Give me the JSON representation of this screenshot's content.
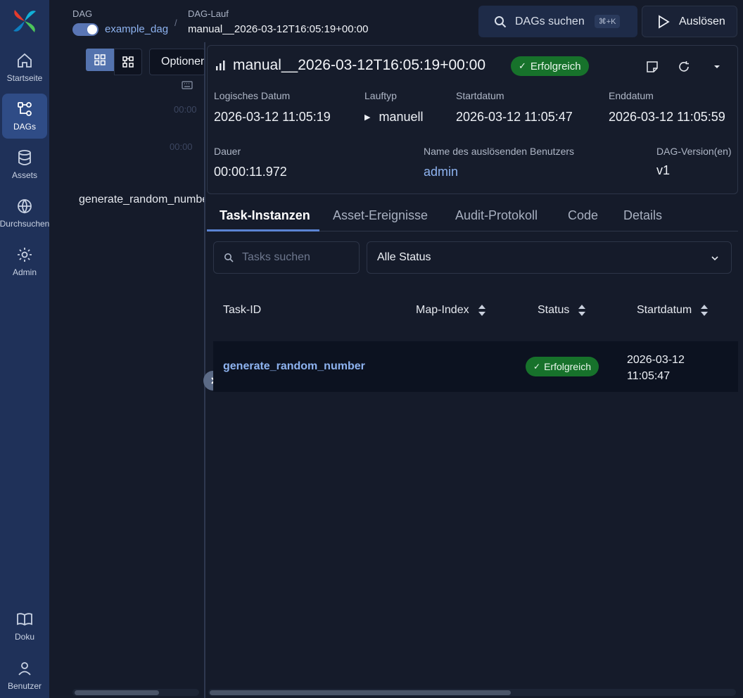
{
  "sidebar": {
    "items": [
      {
        "label": "Startseite",
        "icon": "home-icon"
      },
      {
        "label": "DAGs",
        "icon": "dags-icon"
      },
      {
        "label": "Assets",
        "icon": "database-icon"
      },
      {
        "label": "Durchsuchen",
        "icon": "globe-icon"
      },
      {
        "label": "Admin",
        "icon": "gear-icon"
      }
    ],
    "bottom": [
      {
        "label": "Doku",
        "icon": "book-icon"
      },
      {
        "label": "Benutzer",
        "icon": "user-icon"
      }
    ]
  },
  "header": {
    "dag_label": "DAG",
    "dag_name": "example_dag",
    "run_label": "DAG-Lauf",
    "run_name": "manual__2026-03-12T16:05:19+00:00",
    "search_placeholder": "DAGs suchen",
    "search_shortcut": "⌘+K",
    "trigger_label": "Auslösen"
  },
  "left_panel": {
    "options_label": "Optionen",
    "time_1": "00:00",
    "time_2": "00:00",
    "task_name": "generate_random_number"
  },
  "run": {
    "title": "manual__2026-03-12T16:05:19+00:00",
    "status": "Erfolgreich",
    "fields": {
      "logical_date_label": "Logisches Datum",
      "logical_date": "2026-03-12 11:05:19",
      "run_type_label": "Lauftyp",
      "run_type": "manuell",
      "start_label": "Startdatum",
      "start": "2026-03-12 11:05:47",
      "end_label": "Enddatum",
      "end": "2026-03-12 11:05:59",
      "duration_label": "Dauer",
      "duration": "00:00:11.972",
      "user_label": "Name des auslösenden Benutzers",
      "user": "admin",
      "version_label": "DAG-Version(en)",
      "version": "v1"
    }
  },
  "tabs": [
    "Task-Instanzen",
    "Asset-Ereignisse",
    "Audit-Protokoll",
    "Code",
    "Details"
  ],
  "filters": {
    "task_search_placeholder": "Tasks suchen",
    "status_value": "Alle Status"
  },
  "table": {
    "columns": [
      "Task-ID",
      "Map-Index",
      "Status",
      "Startdatum"
    ],
    "rows": [
      {
        "task_id": "generate_random_number",
        "map_index": "",
        "status": "Erfolgreich",
        "start_line1": "2026-03-12",
        "start_line2": "11:05:47"
      }
    ]
  },
  "colors": {
    "sidebar_bg": "#1f3159",
    "accent": "#8eb3f0",
    "success": "#17722b",
    "background": "#151b2a"
  }
}
